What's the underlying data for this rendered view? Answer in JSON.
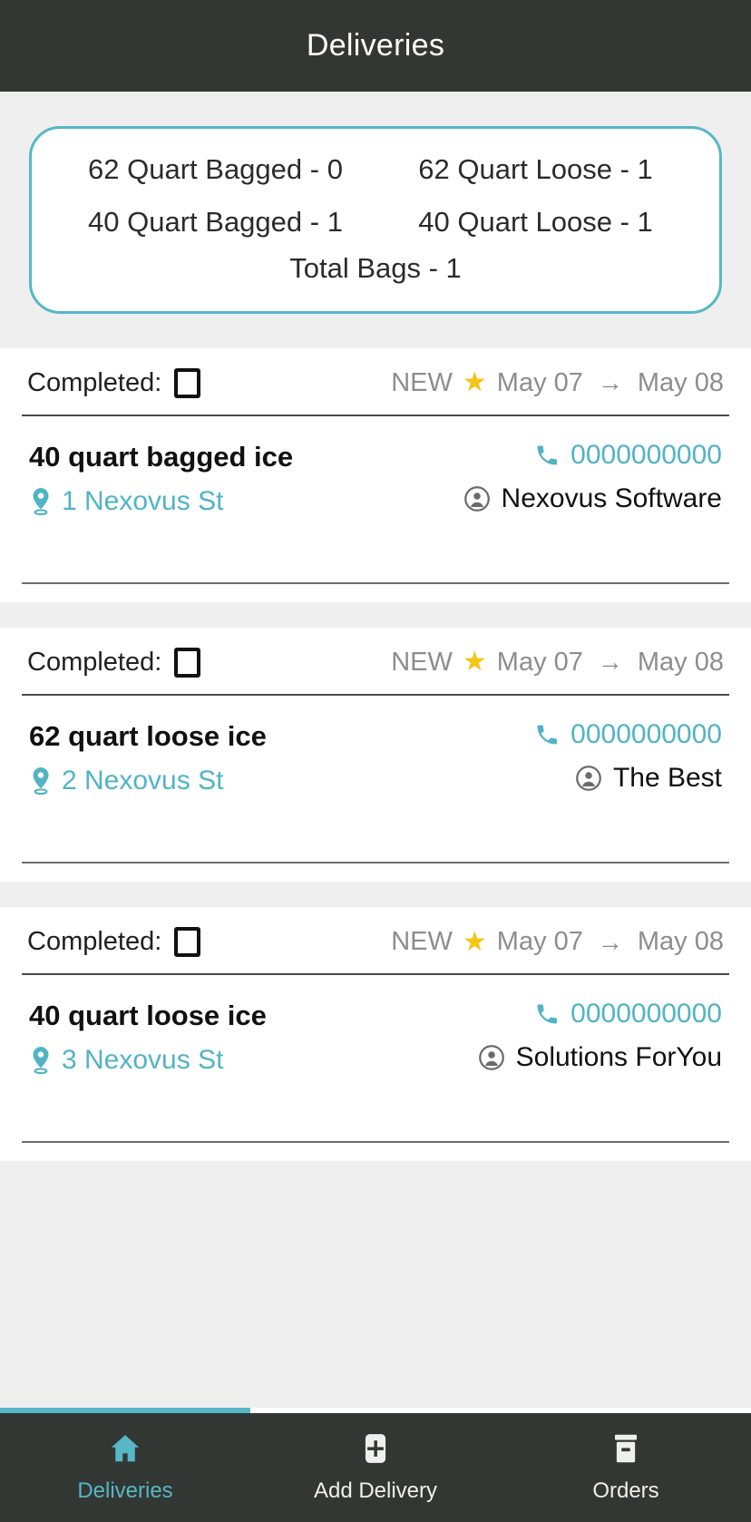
{
  "header": {
    "title": "Deliveries"
  },
  "summary": {
    "rows": [
      {
        "left": "62 Quart Bagged - 0",
        "right": "62 Quart Loose - 1"
      },
      {
        "left": "40 Quart Bagged - 1",
        "right": "40 Quart Loose - 1"
      }
    ],
    "total": "Total Bags - 1"
  },
  "labels": {
    "completed": "Completed:",
    "status_new": "NEW",
    "arrow": "→"
  },
  "icons": {
    "star": "star-icon",
    "map_pin": "map-pin-icon",
    "phone": "phone-icon",
    "person": "person-icon",
    "home": "home-icon",
    "plus": "plus-icon",
    "archive": "archive-icon"
  },
  "colors": {
    "accent_teal": "#51b4c4",
    "header_dark": "#333733",
    "star_yellow": "#f3c516",
    "page_gray": "#efefef"
  },
  "deliveries": [
    {
      "completed_label": "Completed:",
      "status": "NEW",
      "date_from": "May 07",
      "date_to": "May 08",
      "product": "40 quart bagged ice",
      "address": "1 Nexovus St",
      "phone": "0000000000",
      "customer": "Nexovus Software"
    },
    {
      "completed_label": "Completed:",
      "status": "NEW",
      "date_from": "May 07",
      "date_to": "May 08",
      "product": "62 quart loose ice",
      "address": "2 Nexovus St",
      "phone": "0000000000",
      "customer": "The Best"
    },
    {
      "completed_label": "Completed:",
      "status": "NEW",
      "date_from": "May 07",
      "date_to": "May 08",
      "product": "40 quart loose ice",
      "address": "3 Nexovus St",
      "phone": "0000000000",
      "customer": "Solutions ForYou"
    }
  ],
  "bottom_nav": {
    "items": [
      {
        "label": "Deliveries",
        "icon": "home-icon",
        "active": true
      },
      {
        "label": "Add Delivery",
        "icon": "plus-icon",
        "active": false
      },
      {
        "label": "Orders",
        "icon": "archive-icon",
        "active": false
      }
    ]
  }
}
